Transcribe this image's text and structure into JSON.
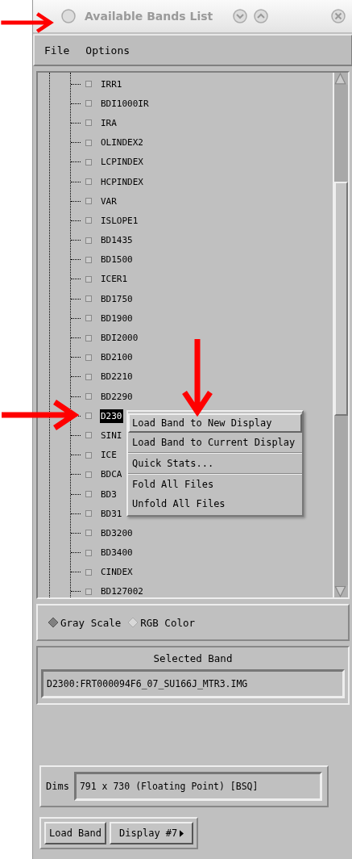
{
  "window": {
    "title": "Available Bands List"
  },
  "menu_bar": [
    "File",
    "Options"
  ],
  "bands": [
    {
      "name": "IRR1",
      "selected": false
    },
    {
      "name": "BDI1000IR",
      "selected": false
    },
    {
      "name": "IRA",
      "selected": false
    },
    {
      "name": "OLINDEX2",
      "selected": false
    },
    {
      "name": "LCPINDEX",
      "selected": false
    },
    {
      "name": "HCPINDEX",
      "selected": false
    },
    {
      "name": "VAR",
      "selected": false
    },
    {
      "name": "ISLOPE1",
      "selected": false
    },
    {
      "name": "BD1435",
      "selected": false
    },
    {
      "name": "BD1500",
      "selected": false
    },
    {
      "name": "ICER1",
      "selected": false
    },
    {
      "name": "BD1750",
      "selected": false
    },
    {
      "name": "BD1900",
      "selected": false
    },
    {
      "name": "BDI2000",
      "selected": false
    },
    {
      "name": "BD2100",
      "selected": false
    },
    {
      "name": "BD2210",
      "selected": false
    },
    {
      "name": "BD2290",
      "selected": false
    },
    {
      "name": "D230",
      "selected": true
    },
    {
      "name": "SINI",
      "selected": false
    },
    {
      "name": "ICE",
      "selected": false
    },
    {
      "name": "BDCA",
      "selected": false
    },
    {
      "name": "BD3",
      "selected": false
    },
    {
      "name": "BD31",
      "selected": false
    },
    {
      "name": "BD3200",
      "selected": false
    },
    {
      "name": "BD3400",
      "selected": false
    },
    {
      "name": "CINDEX",
      "selected": false
    },
    {
      "name": "BD127002",
      "selected": false
    }
  ],
  "context_menu": [
    {
      "label": "Load Band to New Display",
      "selected": true,
      "separator_after": false
    },
    {
      "label": "Load Band to Current Display",
      "selected": false,
      "separator_after": true
    },
    {
      "label": "Quick Stats...",
      "selected": false,
      "separator_after": true
    },
    {
      "label": "Fold All Files",
      "selected": false,
      "separator_after": false
    },
    {
      "label": "Unfold All Files",
      "selected": false,
      "separator_after": false
    }
  ],
  "color_mode": [
    {
      "label": "Gray Scale",
      "selected": true
    },
    {
      "label": "RGB Color",
      "selected": false
    }
  ],
  "selected_band": {
    "heading": "Selected Band",
    "value": "D2300:FRT000094F6_07_SU166J_MTR3.IMG"
  },
  "dims": {
    "label": "Dims",
    "value": "791 x 730 (Floating Point) [BSQ]"
  },
  "buttons": {
    "load": "Load Band",
    "display": "Display #7"
  }
}
